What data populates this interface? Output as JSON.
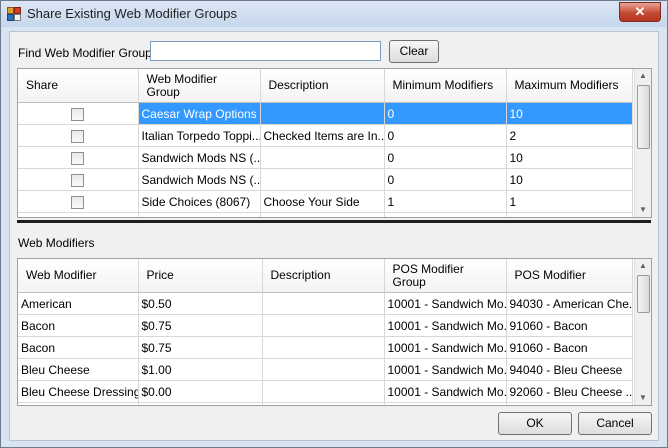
{
  "window": {
    "title": "Share Existing Web Modifier Groups",
    "close_glyph": "✕"
  },
  "find": {
    "label": "Find Web Modifier Groups",
    "value": "",
    "clear_label": "Clear"
  },
  "groups_grid": {
    "columns": [
      "Share",
      "Web Modifier Group",
      "Description",
      "Minimum Modifiers",
      "Maximum Modifiers"
    ],
    "rows": [
      {
        "share": false,
        "group": "Caesar Wrap Options ...",
        "description": "",
        "min": "0",
        "max": "10",
        "selected": true
      },
      {
        "share": false,
        "group": "Italian Torpedo Toppi...",
        "description": "Checked Items are In...",
        "min": "0",
        "max": "2"
      },
      {
        "share": false,
        "group": "Sandwich Mods NS (...",
        "description": "",
        "min": "0",
        "max": "10"
      },
      {
        "share": false,
        "group": "Sandwich Mods NS (...",
        "description": "",
        "min": "0",
        "max": "10"
      },
      {
        "share": false,
        "group": "Side Choices (8067)",
        "description": "Choose Your Side",
        "min": "1",
        "max": "1"
      }
    ]
  },
  "modifiers_section": {
    "label": "Web Modifiers"
  },
  "modifiers_grid": {
    "columns": [
      "Web Modifier",
      "Price",
      "Description",
      "POS Modifier Group",
      "POS Modifier"
    ],
    "rows": [
      {
        "modifier": "American",
        "price": "$0.50",
        "description": "",
        "pos_group": "10001 - Sandwich Mo...",
        "pos_modifier": "94030 - American Che..."
      },
      {
        "modifier": "Bacon",
        "price": "$0.75",
        "description": "",
        "pos_group": "10001 - Sandwich Mo...",
        "pos_modifier": "91060 - Bacon"
      },
      {
        "modifier": "Bacon",
        "price": "$0.75",
        "description": "",
        "pos_group": "10001 - Sandwich Mo...",
        "pos_modifier": "91060 - Bacon"
      },
      {
        "modifier": "Bleu Cheese",
        "price": "$1.00",
        "description": "",
        "pos_group": "10001 - Sandwich Mo...",
        "pos_modifier": "94040 - Bleu Cheese"
      },
      {
        "modifier": "Bleu Cheese Dressing",
        "price": "$0.00",
        "description": "",
        "pos_group": "10001 - Sandwich Mo...",
        "pos_modifier": "92060 - Bleu Cheese ..."
      }
    ]
  },
  "footer": {
    "ok_label": "OK",
    "cancel_label": "Cancel"
  },
  "colors": {
    "selection": "#3399ff",
    "title_bg": "#dce7f5",
    "close_red": "#c44b34"
  },
  "icons": {
    "app": "app-icon",
    "scroll_up": "scroll-up-icon",
    "scroll_down": "scroll-down-icon"
  }
}
